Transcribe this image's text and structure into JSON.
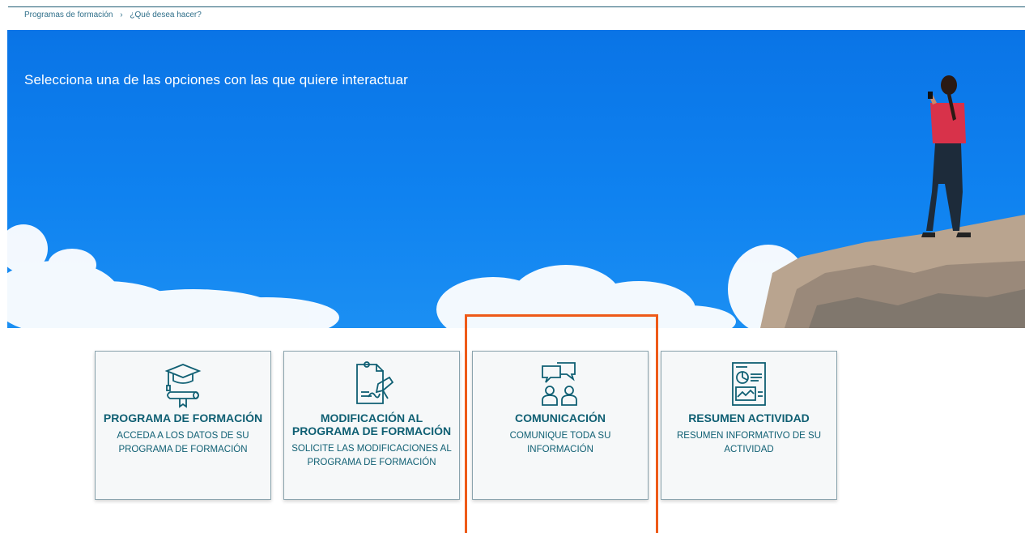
{
  "breadcrumb": {
    "item1": "Programas de formación",
    "separator": "›",
    "item2": "¿Qué desea hacer?"
  },
  "hero": {
    "title": "Selecciona una de las opciones con las que quiere interactuar"
  },
  "cards": [
    {
      "icon": "graduation-cap-diploma-icon",
      "title": "PROGRAMA DE FORMACIÓN",
      "desc": "ACCEDA A LOS DATOS DE SU PROGRAMA DE FORMACIÓN"
    },
    {
      "icon": "document-signature-icon",
      "title": "MODIFICACIÓN AL PROGRAMA DE FORMACIÓN",
      "desc": "SOLICITE LAS MODIFICACIONES AL PROGRAMA DE FORMACIÓN"
    },
    {
      "icon": "chat-people-icon",
      "title": "COMUNICACIÓN",
      "desc": "COMUNIQUE TODA SU INFORMACIÓN"
    },
    {
      "icon": "report-chart-icon",
      "title": "RESUMEN ACTIVIDAD",
      "desc": "RESUMEN INFORMATIVO DE SU ACTIVIDAD"
    }
  ],
  "colors": {
    "hero_blue": "#0f82f0",
    "card_text": "#0f5f73",
    "highlight": "#ee5a18"
  }
}
